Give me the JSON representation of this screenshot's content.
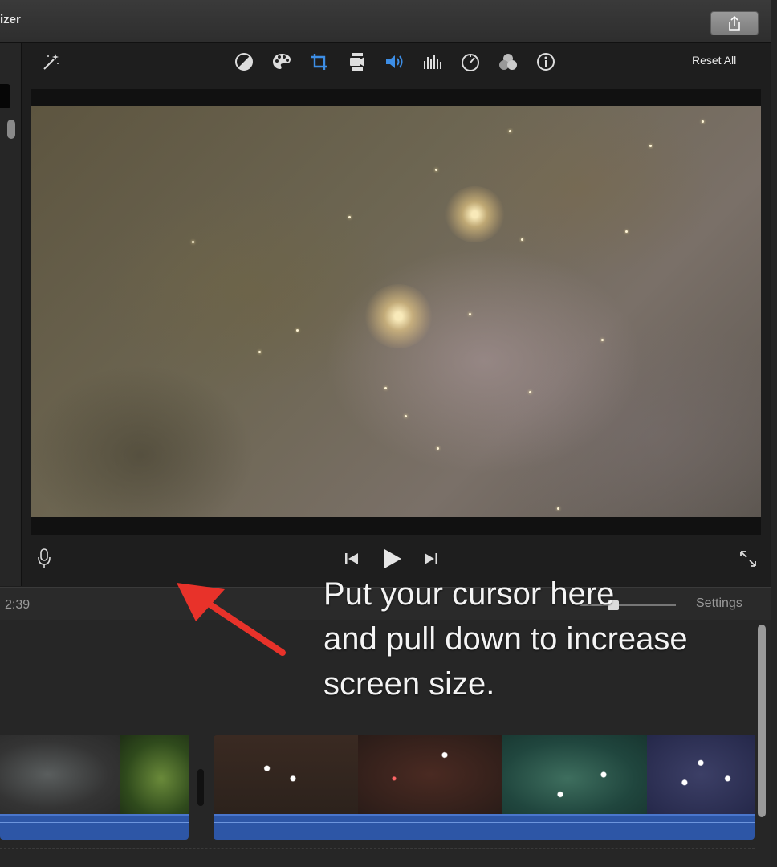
{
  "window": {
    "title_fragment": "izer",
    "share_icon": "share-icon"
  },
  "toolbar": {
    "icons": [
      {
        "name": "magic-wand-icon",
        "active": false
      },
      {
        "name": "color-balance-icon",
        "active": false
      },
      {
        "name": "color-palette-icon",
        "active": false
      },
      {
        "name": "crop-icon",
        "active": true
      },
      {
        "name": "stabilization-camera-icon",
        "active": false
      },
      {
        "name": "volume-icon",
        "active": true
      },
      {
        "name": "equalizer-icon",
        "active": false
      },
      {
        "name": "speed-icon",
        "active": false
      },
      {
        "name": "clip-filter-icon",
        "active": false
      },
      {
        "name": "info-icon",
        "active": false
      }
    ],
    "reset_all_label": "Reset All",
    "accent_color": "#3d8ee6"
  },
  "transport": {
    "mic_icon": "microphone-icon",
    "prev_icon": "skip-back-icon",
    "play_icon": "play-icon",
    "next_icon": "skip-forward-icon",
    "fullscreen_icon": "fullscreen-icon"
  },
  "timeline_bar": {
    "timecode": "2:39",
    "settings_label": "Settings"
  },
  "annotation": {
    "text": "Put your cursor here\nand pull down to increase\nscreen size.",
    "arrow_color": "#e8322a"
  },
  "timeline": {
    "audio_color": "#2d56a6"
  }
}
